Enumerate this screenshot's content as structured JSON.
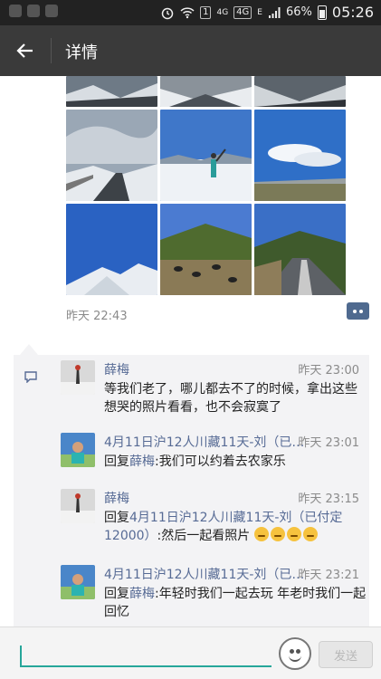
{
  "status_bar": {
    "sim_badge": "1",
    "net_4g": "4G",
    "net_4g_box": "4G",
    "net_e": "E",
    "battery": "66%",
    "time": "05:26"
  },
  "header": {
    "title": "详情"
  },
  "post": {
    "time": "昨天 22:43"
  },
  "comments": [
    {
      "name": "薛梅",
      "time": "昨天 23:00",
      "text": "等我们老了，哪儿都去不了的时候，拿出这些想哭的照片看看，也不会寂寞了"
    },
    {
      "name": "4月11日沪12人川藏11天-刘（已…",
      "time": "昨天 23:01",
      "reply_prefix": "回复",
      "reply_to": "薛梅",
      "text": ":我们可以约着去农家乐"
    },
    {
      "name": "薛梅",
      "time": "昨天 23:15",
      "reply_prefix": "回复",
      "reply_to": "4月11日沪12人川藏11天-刘（已付定12000）",
      "text": ":然后一起看照片"
    },
    {
      "name": "4月11日沪12人川藏11天-刘（已…",
      "time": "昨天 23:21",
      "reply_prefix": "回复",
      "reply_to": "薛梅",
      "text": ":年轻时我们一起去玩 年老时我们一起回忆"
    }
  ],
  "input_bar": {
    "send_label": "发送"
  },
  "colors": {
    "link": "#576b95",
    "accent": "#26a69a",
    "header_bg": "#3a3a3a"
  }
}
